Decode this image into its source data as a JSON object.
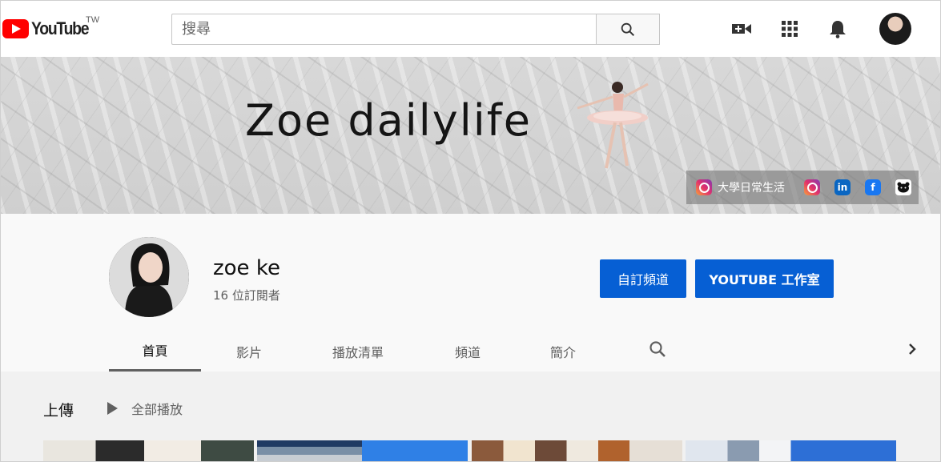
{
  "masthead": {
    "logo_text": "YouTube",
    "country_code": "TW",
    "search_placeholder": "搜尋"
  },
  "banner": {
    "title": "Zoe dailylife",
    "social_links": [
      {
        "icon": "instagram-icon",
        "label": "大學日常生活"
      },
      {
        "icon": "instagram-icon",
        "label": ""
      },
      {
        "icon": "linkedin-icon",
        "label": ""
      },
      {
        "icon": "facebook-icon",
        "label": ""
      },
      {
        "icon": "bear-icon",
        "label": ""
      }
    ]
  },
  "channel": {
    "name": "zoe ke",
    "subscribers": "16 位訂閱者",
    "customize_button": "自訂頻道",
    "studio_button": "YOUTUBE 工作室"
  },
  "tabs": [
    {
      "label": "首頁",
      "active": true
    },
    {
      "label": "影片",
      "active": false
    },
    {
      "label": "播放清單",
      "active": false
    },
    {
      "label": "頻道",
      "active": false
    },
    {
      "label": "簡介",
      "active": false
    }
  ],
  "shelf": {
    "title": "上傳",
    "play_all": "全部播放"
  },
  "colors": {
    "accent": "#065fd4",
    "brand_red": "#ff0000"
  }
}
